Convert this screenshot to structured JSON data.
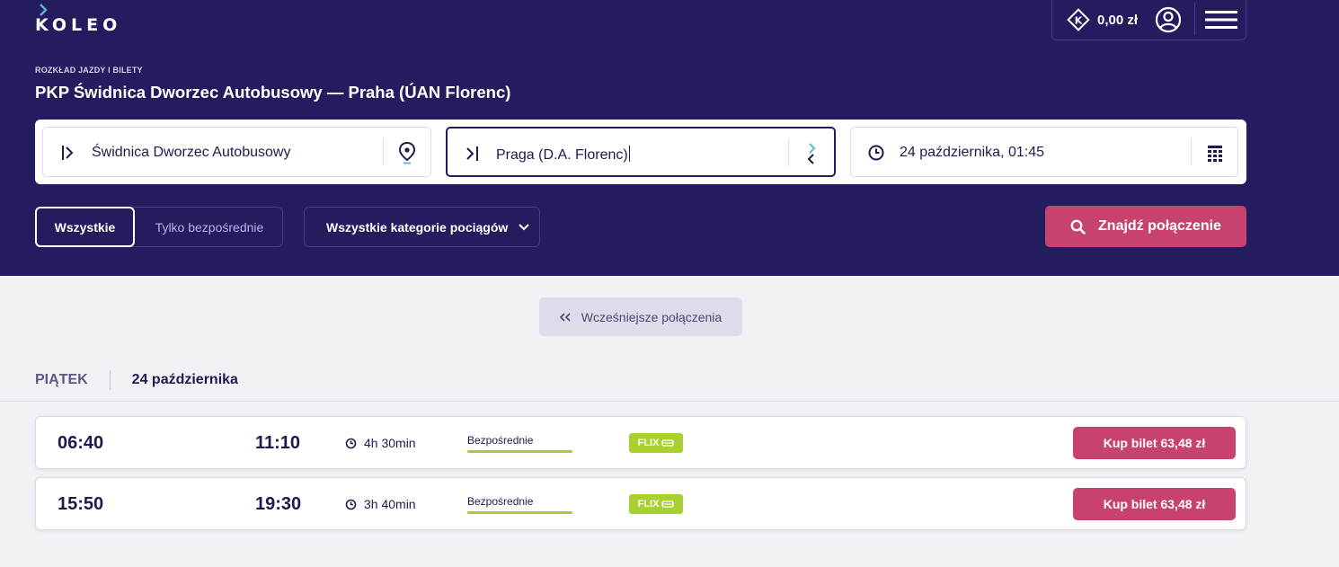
{
  "brand": {
    "logo_text": "KOLEO",
    "primary_color": "#231c5f",
    "accent_color": "#c7436e",
    "flix_color": "#a8d02e",
    "logo_mark_color": "#5fb8c9"
  },
  "header": {
    "wallet_balance": "0,00 zł",
    "kicker": "ROZKŁAD JAZDY I BILETY",
    "title": "PKP Świdnica Dworzec Autobusowy — Praha (ÚAN Florenc)"
  },
  "search": {
    "from": "Świdnica Dworzec Autobusowy",
    "to": "Praga (D.A. Florenc)",
    "datetime": "24 października, 01:45",
    "icons": {
      "from": "departure-icon",
      "from_action": "location-pin-icon",
      "to": "arrival-icon",
      "swap": "swap-icon",
      "time": "clock-icon",
      "calendar": "calendar-icon"
    }
  },
  "filters": {
    "all": "Wszystkie",
    "direct_only": "Tylko bezpośrednie",
    "categories": "Wszystkie kategorie pociągów"
  },
  "find_button": "Znajdź połączenie",
  "earlier_button": "Wcześniejsze połączenia",
  "day": {
    "weekday": "PIĄTEK",
    "date": "24 października"
  },
  "connections": [
    {
      "departure": "06:40",
      "arrival": "11:10",
      "duration": "4h 30min",
      "type": "Bezpośrednie",
      "carrier": "FLIX",
      "buy": "Kup bilet 63,48 zł"
    },
    {
      "departure": "15:50",
      "arrival": "19:30",
      "duration": "3h 40min",
      "type": "Bezpośrednie",
      "carrier": "FLIX",
      "buy": "Kup bilet 63,48 zł"
    }
  ]
}
